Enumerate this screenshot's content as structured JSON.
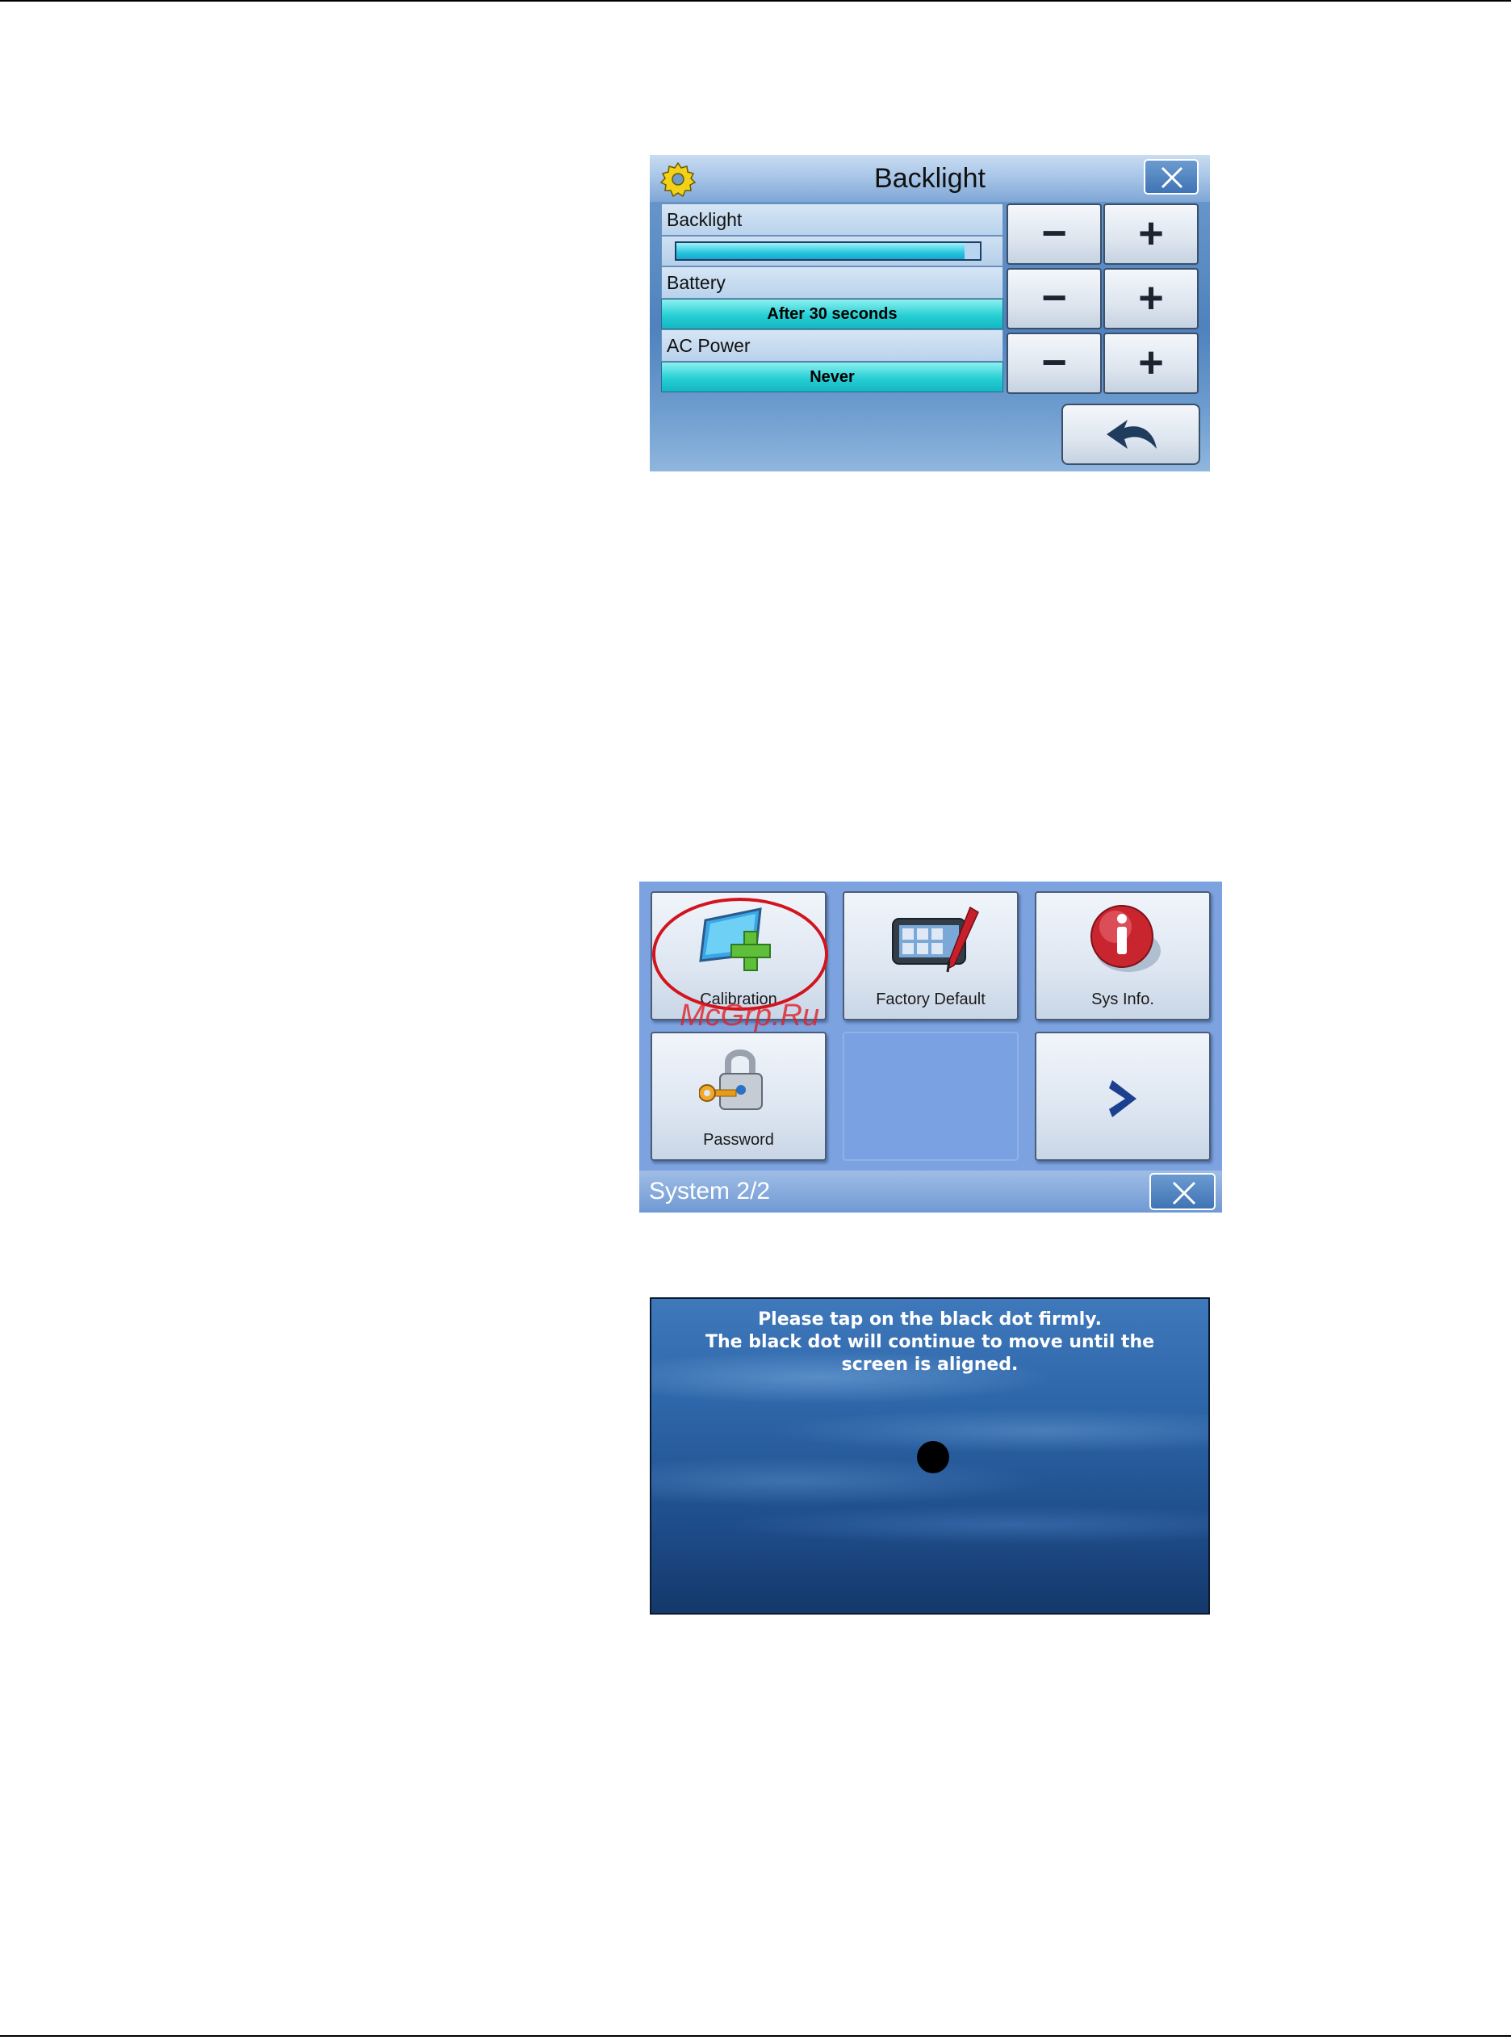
{
  "backlight_screen": {
    "title": "Backlight",
    "icons": {
      "settings": "gear-icon",
      "close": "close-icon",
      "back": "undo-arrow-icon"
    },
    "rows": [
      {
        "label": "Backlight",
        "level": 0.95
      },
      {
        "label": "Battery",
        "value": "After 30 seconds"
      },
      {
        "label": "AC Power",
        "value": "Never"
      }
    ],
    "decrease_label": "−",
    "increase_label": "+"
  },
  "system_screen": {
    "title": "System 2/2",
    "tiles": [
      {
        "label": "Calibration",
        "icon": "calibration-icon"
      },
      {
        "label": "Factory Default",
        "icon": "factory-default-icon"
      },
      {
        "label": "Sys Info.",
        "icon": "info-icon"
      },
      {
        "label": "Password",
        "icon": "padlock-key-icon"
      },
      {
        "label": "",
        "icon": ""
      },
      {
        "label": "",
        "icon": "chevron-right-icon"
      }
    ],
    "watermark": "McGrp.Ru",
    "colors": {
      "highlight": "#d2141e",
      "chevron": "#1d3f8f"
    }
  },
  "calibration_screen": {
    "message_lines": [
      "Please tap on the black dot firmly.",
      "The black dot will continue to move until the",
      "screen is aligned."
    ]
  }
}
